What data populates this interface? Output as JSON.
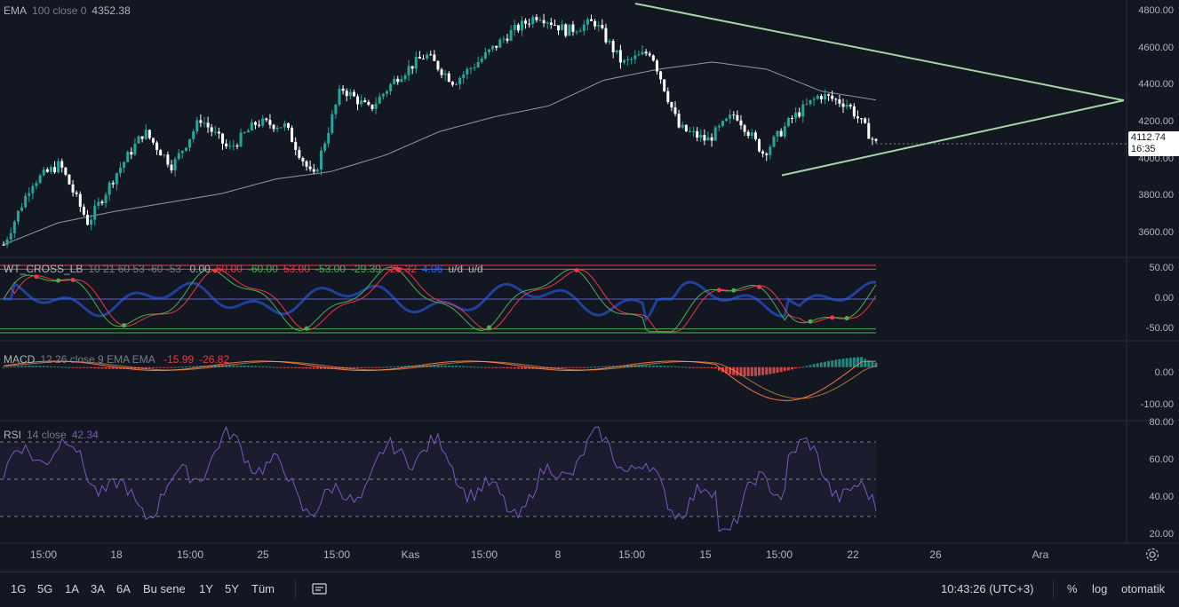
{
  "colors": {
    "background": "#131722",
    "up": "#26a69a",
    "down": "#ffffff",
    "ema": "#9598a1",
    "triangle": "#a5d6a7",
    "wt_line": "#2196f3",
    "red": "#f23645",
    "green": "#4caf50",
    "macd_line": "#ff7043",
    "rsi_line": "#7e57c2"
  },
  "legends": {
    "ema": {
      "name": "EMA",
      "params": "100 close 0",
      "value": "4352.38"
    },
    "wt": {
      "name": "WT_CROSS_LB",
      "params": "10 21 60 53 -60 -53",
      "values": [
        {
          "text": "0.00",
          "color": "#b2b5be"
        },
        {
          "text": "60.00",
          "color": "#f23645"
        },
        {
          "text": "-60.00",
          "color": "#4caf50"
        },
        {
          "text": "53.00",
          "color": "#f23645"
        },
        {
          "text": "-53.00",
          "color": "#4caf50"
        },
        {
          "text": "-29.39",
          "color": "#4caf50"
        },
        {
          "text": "-25.32",
          "color": "#f23645"
        },
        {
          "text": "4.06",
          "color": "#2962ff"
        },
        {
          "text": "u/d",
          "color": "#b2b5be"
        },
        {
          "text": "u/d",
          "color": "#b2b5be"
        }
      ]
    },
    "macd": {
      "name": "MACD",
      "params": "12 26 close 9 EMA EMA",
      "values": [
        {
          "text": "-15.99",
          "color": "#f23645"
        },
        {
          "text": "-26.82",
          "color": "#f23645"
        }
      ]
    },
    "rsi": {
      "name": "RSI",
      "params": "14 close",
      "value": "42.34"
    }
  },
  "price_axis": [
    "4800.00",
    "4600.00",
    "4400.00",
    "4200.00",
    "4000.00",
    "3800.00",
    "3600.00"
  ],
  "wt_axis": [
    "50.00",
    "0.00",
    "-50.00"
  ],
  "macd_axis": [
    "0.00",
    "-100.00"
  ],
  "rsi_axis": [
    "80.00",
    "60.00",
    "40.00",
    "20.00"
  ],
  "last_price": {
    "value": "4112.74",
    "countdown": "16:35"
  },
  "time_axis": [
    "15:00",
    "18",
    "15:00",
    "25",
    "15:00",
    "Kas",
    "15:00",
    "8",
    "15:00",
    "15",
    "15:00",
    "22",
    "26",
    "Ara"
  ],
  "toolbar": {
    "intervals": [
      "1G",
      "5G",
      "1A",
      "3A",
      "6A",
      "Bu sene",
      "1Y",
      "5Y",
      "Tüm"
    ],
    "compare_icon": "compare-icon",
    "clock": "10:43:26 (UTC+3)",
    "percent": "%",
    "log": "log",
    "auto": "otomatik"
  },
  "chart_data": {
    "type": "candlestick",
    "price_ylim": [
      3520,
      4880
    ],
    "close_anchors": [
      3560,
      3900,
      4000,
      3680,
      3950,
      4180,
      3990,
      4250,
      4080,
      4230,
      4210,
      3920,
      4420,
      4300,
      4480,
      4600,
      4450,
      4580,
      4720,
      4820,
      4730,
      4780,
      4550,
      4620,
      4200,
      4130,
      4280,
      4060,
      4250,
      4380,
      4330,
      4112.74
    ],
    "ema_anchors": [
      3560,
      3680,
      3740,
      3790,
      3840,
      3920,
      3960,
      4050,
      4180,
      4260,
      4320,
      4460,
      4520,
      4560,
      4520,
      4400,
      4352.38
    ],
    "triangle": {
      "upper": {
        "start": [
          -6,
          4880
        ],
        "end": [
          0,
          4350
        ]
      },
      "lower": {
        "start": [
          -3.5,
          3950
        ],
        "end": [
          0,
          4350
        ]
      }
    },
    "wt_ylim": [
      -60,
      60
    ],
    "macd_ylim": [
      -130,
      60
    ],
    "rsi_ylim": [
      20,
      80
    ],
    "rsi_bands": [
      70,
      50,
      30
    ]
  }
}
